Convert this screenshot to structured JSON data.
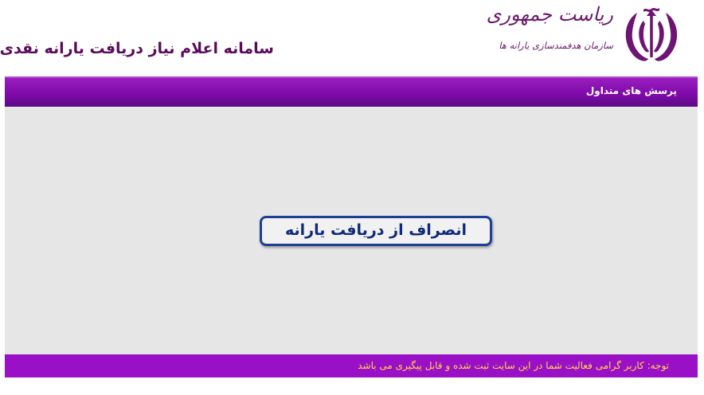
{
  "header": {
    "site_title": "سامانه اعلام نیاز دریافت یارانه نقدی",
    "presidency": "ریاست جمهوری",
    "organization": "سازمان هدفمندسازی یارانه ها",
    "emblem_icon": "iran-emblem-icon"
  },
  "nav": {
    "faq_label": "پرسش های متداول"
  },
  "main": {
    "cancel_button_label": "انصراف از دریافت یارانه"
  },
  "footer": {
    "note": "توجه: کاربر گرامی فعالیت شما در این سایت ثبت شده و قابل پیگیری می باشد"
  },
  "colors": {
    "brand_purple": "#800aaa",
    "footer_purple": "#9a10c6",
    "title_color": "#5b0a5b",
    "button_border": "#1d3f97",
    "note_yellow": "#ffd84a",
    "content_bg": "#e6e6e6"
  }
}
